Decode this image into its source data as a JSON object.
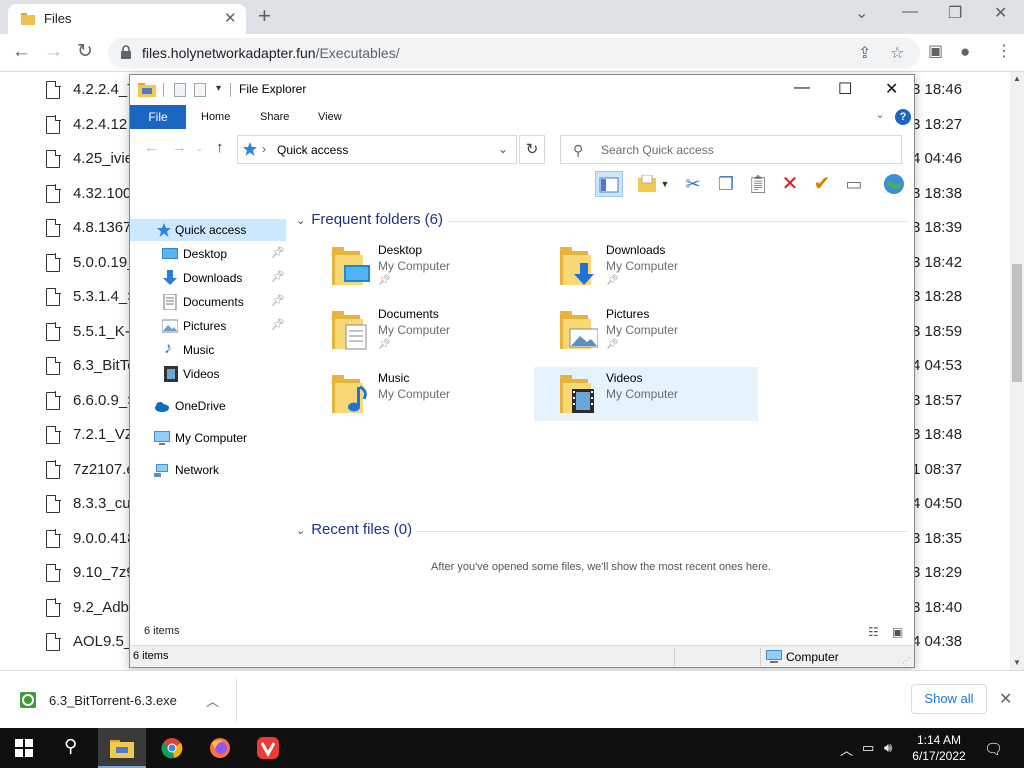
{
  "browser": {
    "tab_title": "Files",
    "url_host": "files.holynetworkadapter.fun",
    "url_path": "/Executables/"
  },
  "file_list": [
    {
      "name": "4.2.2.4_T",
      "date": "3 18:46"
    },
    {
      "name": "4.2.4.12",
      "date": "3 18:27"
    },
    {
      "name": "4.25_ivie",
      "date": "4 04:46"
    },
    {
      "name": "4.32.100",
      "date": "3 18:38"
    },
    {
      "name": "4.8.1367",
      "date": "3 18:39"
    },
    {
      "name": "5.0.0.19_",
      "date": "3 18:42"
    },
    {
      "name": "5.3.1.4_S",
      "date": "3 18:28"
    },
    {
      "name": "5.5.1_K-",
      "date": "3 18:59"
    },
    {
      "name": "6.3_BitTo",
      "date": "4 04:53"
    },
    {
      "name": "6.6.0.9_S",
      "date": "3 18:57"
    },
    {
      "name": "7.2.1_VZ",
      "date": "3 18:48"
    },
    {
      "name": "7z2107.e",
      "date": "1 08:37"
    },
    {
      "name": "8.3.3_cu",
      "date": "4 04:50"
    },
    {
      "name": "9.0.0.418",
      "date": "3 18:35"
    },
    {
      "name": "9.10_7z9",
      "date": "3 18:29"
    },
    {
      "name": "9.2_Adb",
      "date": "3 18:40"
    },
    {
      "name": "AOL9.5_",
      "date": "4 04:38"
    }
  ],
  "explorer": {
    "title": "File Explorer",
    "tabs": {
      "file": "File",
      "home": "Home",
      "share": "Share",
      "view": "View"
    },
    "help": "?",
    "address": "Quick access",
    "search_placeholder": "Search Quick access",
    "nav": [
      {
        "label": "Quick access"
      },
      {
        "label": "Desktop"
      },
      {
        "label": "Downloads"
      },
      {
        "label": "Documents"
      },
      {
        "label": "Pictures"
      },
      {
        "label": "Music"
      },
      {
        "label": "Videos"
      },
      {
        "label": "OneDrive"
      },
      {
        "label": "My Computer"
      },
      {
        "label": "Network"
      }
    ],
    "frequent_header": "Frequent folders (6)",
    "recent_header": "Recent files (0)",
    "folders": [
      {
        "name": "Desktop",
        "location": "My Computer"
      },
      {
        "name": "Downloads",
        "location": "My Computer"
      },
      {
        "name": "Documents",
        "location": "My Computer"
      },
      {
        "name": "Pictures",
        "location": "My Computer"
      },
      {
        "name": "Music",
        "location": "My Computer"
      },
      {
        "name": "Videos",
        "location": "My Computer"
      }
    ],
    "empty_message": "After you've opened some files, we'll show the most recent ones here.",
    "item_count": "6 items",
    "status_count": "6 items",
    "status_location": "Computer"
  },
  "download": {
    "filename": "6.3_BitTorrent-6.3.exe",
    "show_all": "Show all"
  },
  "taskbar": {
    "time": "1:14 AM",
    "date": "6/17/2022"
  },
  "colors": {
    "ribbon_file_tab": "#1a66c2",
    "nav_selected": "#cce8ff",
    "tile_hover": "#e5f3ff",
    "section_header": "#1e3287",
    "taskbar": "#101010"
  }
}
